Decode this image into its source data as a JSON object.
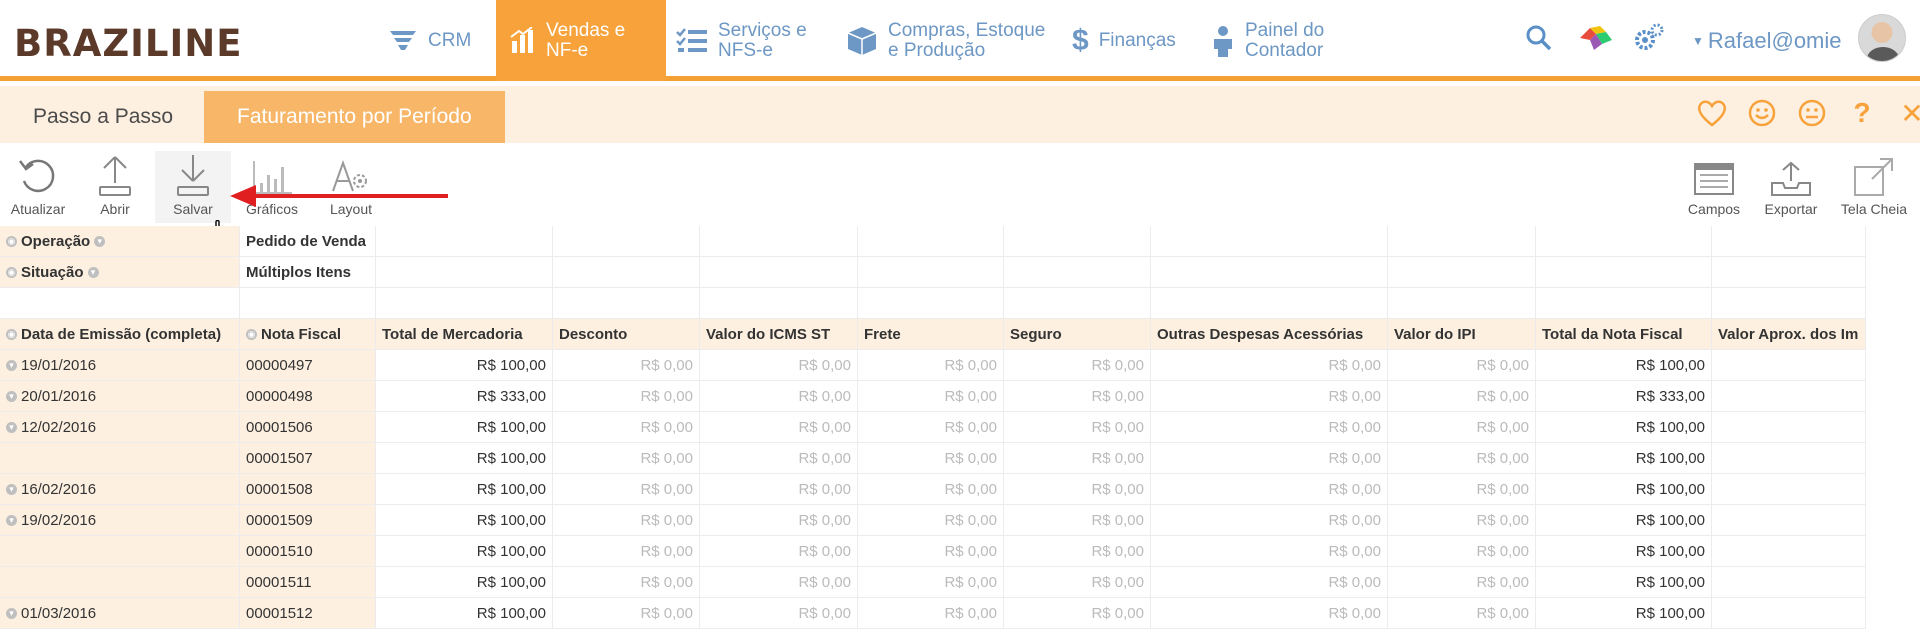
{
  "brand": {
    "logo_text": "BRAZILINE",
    "accent_color": "#f7a23b",
    "nav_text_color": "#6d97c4"
  },
  "nav": {
    "crm": "CRM",
    "vendas_line1": "Vendas e",
    "vendas_line2": "NF-e",
    "servicos_line1": "Serviços e",
    "servicos_line2": "NFS-e",
    "compras_line1": "Compras, Estoque",
    "compras_line2": "e Produção",
    "financas": "Finanças",
    "painel_line1": "Painel do",
    "painel_line2": "Contador"
  },
  "user": {
    "name": "Rafael@omie"
  },
  "tabs": {
    "passo": "Passo a Passo",
    "faturamento": "Faturamento por Período"
  },
  "toolbar": {
    "atualizar": "Atualizar",
    "abrir": "Abrir",
    "salvar": "Salvar",
    "graficos": "Gráficos",
    "layout": "Layout",
    "campos": "Campos",
    "exportar": "Exportar",
    "tela_cheia": "Tela Cheia"
  },
  "filters": [
    {
      "label": "Operação",
      "value": "Pedido de Venda"
    },
    {
      "label": "Situação",
      "value": "Múltiplos Itens"
    }
  ],
  "table": {
    "row_header_1": "Data de Emissão (completa)",
    "row_header_2": "Nota Fiscal",
    "columns": [
      "Total de Mercadoria",
      "Desconto",
      "Valor do ICMS ST",
      "Frete",
      "Seguro",
      "Outras Despesas Acessórias",
      "Valor do IPI",
      "Total da Nota Fiscal",
      "Valor Aprox. dos Im"
    ],
    "rows": [
      {
        "date": "19/01/2016",
        "nf": "00000497",
        "values": [
          "R$ 100,00",
          "R$ 0,00",
          "R$ 0,00",
          "R$ 0,00",
          "R$ 0,00",
          "R$ 0,00",
          "R$ 0,00",
          "R$ 100,00",
          ""
        ]
      },
      {
        "date": "20/01/2016",
        "nf": "00000498",
        "values": [
          "R$ 333,00",
          "R$ 0,00",
          "R$ 0,00",
          "R$ 0,00",
          "R$ 0,00",
          "R$ 0,00",
          "R$ 0,00",
          "R$ 333,00",
          ""
        ]
      },
      {
        "date": "12/02/2016",
        "nf": "00001506",
        "values": [
          "R$ 100,00",
          "R$ 0,00",
          "R$ 0,00",
          "R$ 0,00",
          "R$ 0,00",
          "R$ 0,00",
          "R$ 0,00",
          "R$ 100,00",
          ""
        ]
      },
      {
        "date": "",
        "nf": "00001507",
        "values": [
          "R$ 100,00",
          "R$ 0,00",
          "R$ 0,00",
          "R$ 0,00",
          "R$ 0,00",
          "R$ 0,00",
          "R$ 0,00",
          "R$ 100,00",
          ""
        ]
      },
      {
        "date": "16/02/2016",
        "nf": "00001508",
        "values": [
          "R$ 100,00",
          "R$ 0,00",
          "R$ 0,00",
          "R$ 0,00",
          "R$ 0,00",
          "R$ 0,00",
          "R$ 0,00",
          "R$ 100,00",
          ""
        ]
      },
      {
        "date": "19/02/2016",
        "nf": "00001509",
        "values": [
          "R$ 100,00",
          "R$ 0,00",
          "R$ 0,00",
          "R$ 0,00",
          "R$ 0,00",
          "R$ 0,00",
          "R$ 0,00",
          "R$ 100,00",
          ""
        ]
      },
      {
        "date": "",
        "nf": "00001510",
        "values": [
          "R$ 100,00",
          "R$ 0,00",
          "R$ 0,00",
          "R$ 0,00",
          "R$ 0,00",
          "R$ 0,00",
          "R$ 0,00",
          "R$ 100,00",
          ""
        ]
      },
      {
        "date": "",
        "nf": "00001511",
        "values": [
          "R$ 100,00",
          "R$ 0,00",
          "R$ 0,00",
          "R$ 0,00",
          "R$ 0,00",
          "R$ 0,00",
          "R$ 0,00",
          "R$ 100,00",
          ""
        ]
      },
      {
        "date": "01/03/2016",
        "nf": "00001512",
        "values": [
          "R$ 100,00",
          "R$ 0,00",
          "R$ 0,00",
          "R$ 0,00",
          "R$ 0,00",
          "R$ 0,00",
          "R$ 0,00",
          "R$ 100,00",
          ""
        ]
      }
    ]
  }
}
